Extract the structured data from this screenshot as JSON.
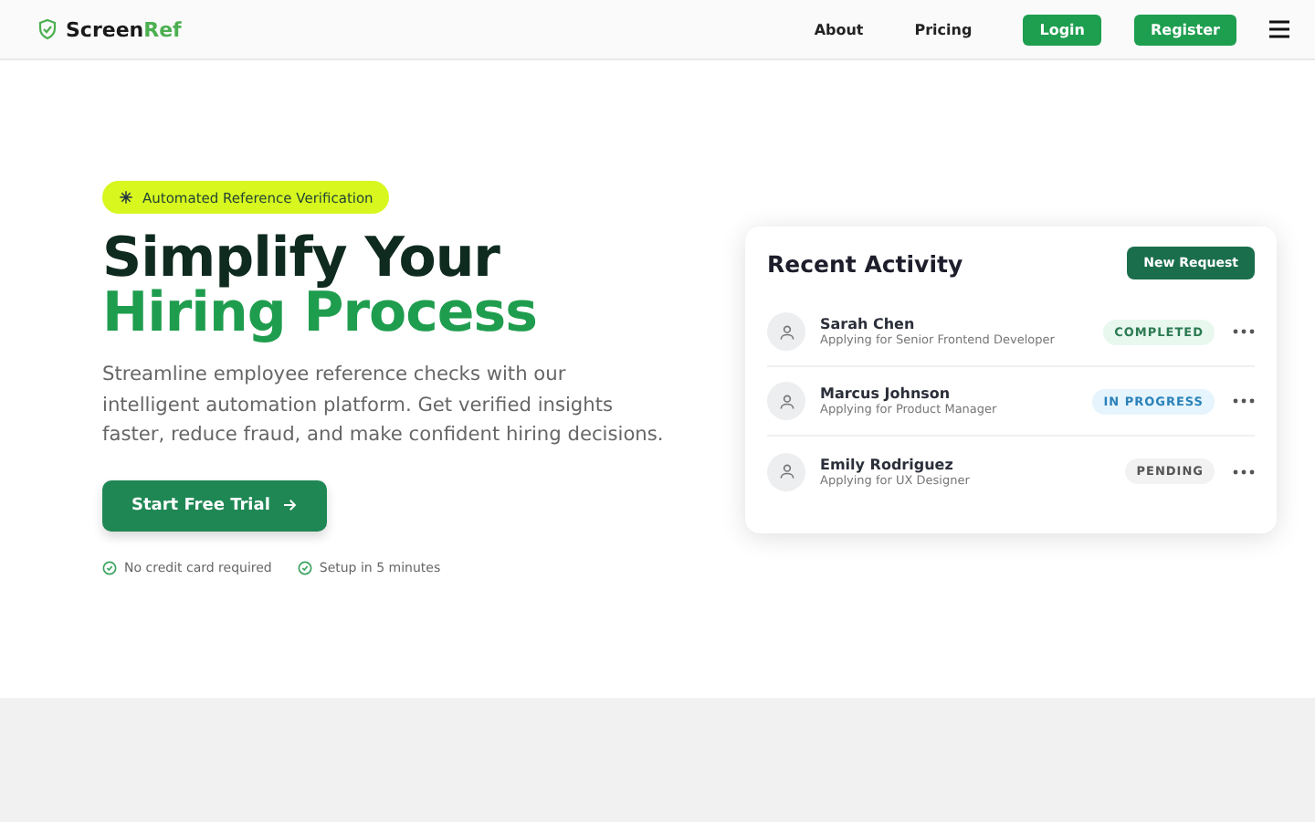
{
  "header": {
    "logo": {
      "part_1": "Screen",
      "part_2": "Ref"
    },
    "nav": [
      "About",
      "Pricing"
    ],
    "buttons": [
      "Login",
      "Register"
    ]
  },
  "hero": {
    "badge": "Automated Reference Verification",
    "headline_1": "Simplify Your",
    "headline_2": "Hiring Process",
    "description": "Streamline employee reference checks with our intelligent automation platform. Get verified insights faster, reduce fraud, and make confident hiring decisions.",
    "cta": "Start Free Trial",
    "features": [
      "No credit card required",
      "Setup in 5 minutes"
    ]
  },
  "activity": {
    "title": "Recent Activity",
    "button": "New Request",
    "rows": [
      {
        "name": "Sarah Chen",
        "role": "Applying for Senior Frontend Developer",
        "status": "COMPLETED",
        "kind": "completed"
      },
      {
        "name": "Marcus Johnson",
        "role": "Applying for Product Manager",
        "status": "IN PROGRESS",
        "kind": "in_progress"
      },
      {
        "name": "Emily Rodriguez",
        "role": "Applying for UX Designer",
        "status": "PENDING",
        "kind": "pending"
      }
    ]
  }
}
